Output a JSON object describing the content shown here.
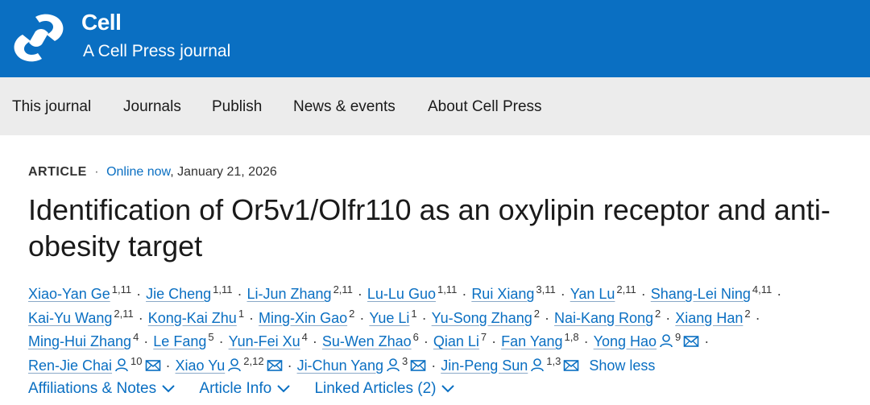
{
  "brand": {
    "logo_icon": "cell-logo-icon",
    "name": "Cell",
    "tagline": "A Cell Press journal",
    "color": "#0a6fc2"
  },
  "nav": {
    "items": [
      "This journal",
      "Journals",
      "Publish",
      "News & events",
      "About Cell Press"
    ]
  },
  "article": {
    "type": "ARTICLE",
    "separator": "·",
    "status": "Online now",
    "date": "January 21, 2026",
    "title": "Identification of Or5v1/Olfr110 as an oxylipin receptor and anti-obesity target"
  },
  "authors": [
    {
      "name": "Xiao-Yan Ge",
      "aff": "1,11"
    },
    {
      "name": "Jie Cheng",
      "aff": "1,11"
    },
    {
      "name": "Li-Jun Zhang",
      "aff": "2,11"
    },
    {
      "name": "Lu-Lu Guo",
      "aff": "1,11"
    },
    {
      "name": "Rui Xiang",
      "aff": "3,11"
    },
    {
      "name": "Yan Lu",
      "aff": "2,11"
    },
    {
      "name": "Shang-Lei Ning",
      "aff": "4,11"
    },
    {
      "name": "Kai-Yu Wang",
      "aff": "2,11"
    },
    {
      "name": "Kong-Kai Zhu",
      "aff": "1"
    },
    {
      "name": "Ming-Xin Gao",
      "aff": "2"
    },
    {
      "name": "Yue Li",
      "aff": "1"
    },
    {
      "name": "Yu-Song Zhang",
      "aff": "2"
    },
    {
      "name": "Nai-Kang Rong",
      "aff": "2"
    },
    {
      "name": "Xiang Han",
      "aff": "2"
    },
    {
      "name": "Ming-Hui Zhang",
      "aff": "4"
    },
    {
      "name": "Le Fang",
      "aff": "5"
    },
    {
      "name": "Yun-Fei Xu",
      "aff": "4"
    },
    {
      "name": "Su-Wen Zhao",
      "aff": "6"
    },
    {
      "name": "Qian Li",
      "aff": "7"
    },
    {
      "name": "Fan Yang",
      "aff": "1,8"
    },
    {
      "name": "Yong Hao",
      "aff": "9",
      "icons": [
        "person-icon",
        "email-icon"
      ]
    },
    {
      "name": "Ren-Jie Chai",
      "aff": "10",
      "icons": [
        "person-icon",
        "email-icon"
      ]
    },
    {
      "name": "Xiao Yu",
      "aff": "2,12",
      "icons": [
        "person-icon",
        "email-icon"
      ]
    },
    {
      "name": "Ji-Chun Yang",
      "aff": "3",
      "icons": [
        "person-icon",
        "email-icon"
      ]
    },
    {
      "name": "Jin-Peng Sun",
      "aff": "1,3",
      "icons": [
        "person-icon",
        "email-icon"
      ]
    }
  ],
  "show_less": "Show less",
  "info_tabs": [
    {
      "label": "Affiliations & Notes",
      "icon": "chevron-down-icon"
    },
    {
      "label": "Article Info",
      "icon": "chevron-down-icon"
    },
    {
      "label": "Linked Articles (2)",
      "icon": "chevron-down-icon"
    }
  ]
}
